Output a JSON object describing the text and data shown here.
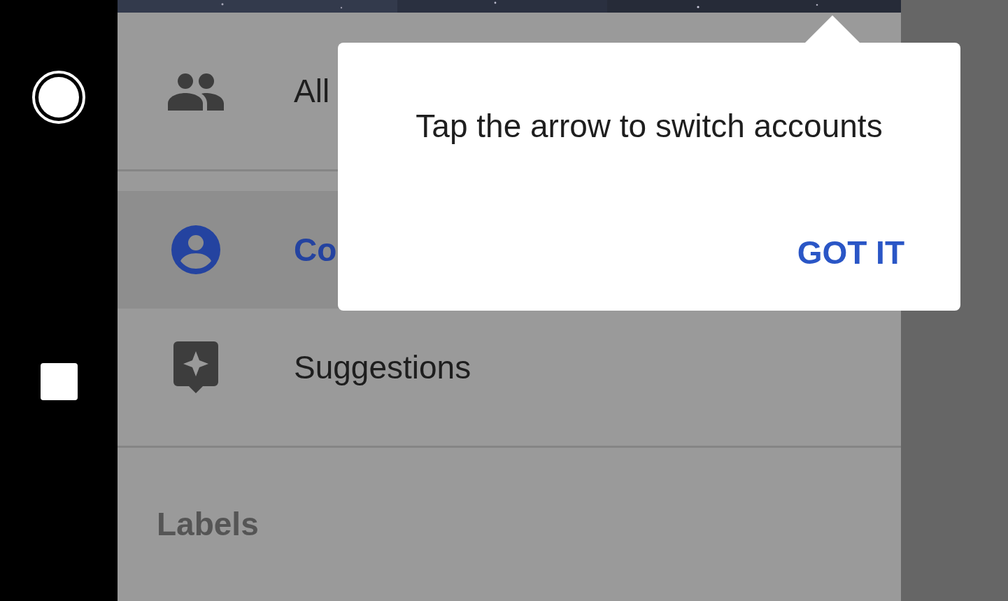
{
  "drawer": {
    "items": [
      {
        "kind": "item",
        "label": "All",
        "selected": false
      },
      {
        "kind": "divider"
      },
      {
        "kind": "item",
        "label": "Co",
        "selected": true
      },
      {
        "kind": "item",
        "label": "Suggestions",
        "selected": false
      },
      {
        "kind": "divider"
      },
      {
        "kind": "header",
        "label": "Labels"
      }
    ]
  },
  "tooltip": {
    "message": "Tap the arrow to switch accounts",
    "button": "GOT IT"
  }
}
